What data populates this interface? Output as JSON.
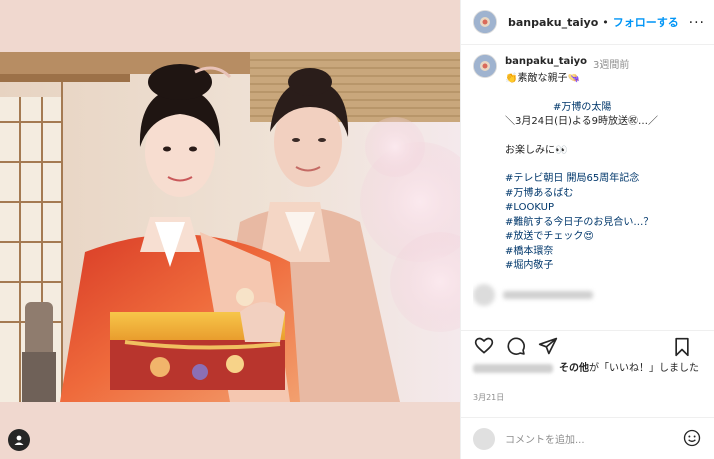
{
  "post": {
    "username": "banpaku_taiyo",
    "separator": "•",
    "follow_label": "フォローする",
    "more_label": "···",
    "time_ago": "3週間前",
    "date": "3月21日"
  },
  "caption": {
    "lines": [
      "👏素敵な親子👒",
      "#万博の太陽",
      "＼3月24日(日)よる9時放送㊗…／",
      "お楽しみに👀",
      "#テレビ朝日 開局65周年記念",
      "#万博あるばむ",
      "#LOOKUP",
      "#難航する今日子のお見合い…？",
      "#放送でチェック😍",
      "#橋本環奈",
      "#堀内敬子"
    ]
  },
  "likes": {
    "text_a": "その他",
    "text_b": "が「いいね！」しました"
  },
  "comment": {
    "placeholder": "コメントを追加..."
  },
  "icons": [
    "tag-user-icon",
    "more-icon",
    "heart-icon",
    "comment-icon",
    "share-icon",
    "bookmark-icon",
    "emoji-icon"
  ],
  "colors": {
    "accent": "#0095f6",
    "hashtag": "#00376b",
    "muted": "#8e8e8e",
    "media_bg": "#f0d8cf"
  }
}
